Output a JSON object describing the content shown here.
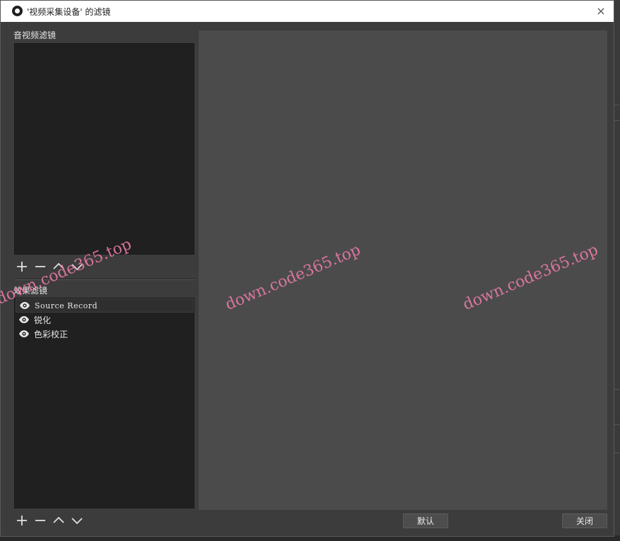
{
  "window": {
    "title": "'视频采集设备' 的滤镜",
    "close_glyph": "×"
  },
  "audio_video_filters": {
    "label": "音视频滤镜",
    "items": []
  },
  "effect_filters": {
    "label": "效果滤镜",
    "items": [
      {
        "label": "Source Record",
        "icon": "eye-icon",
        "selected": true
      },
      {
        "label": "锐化",
        "icon": "eye-icon",
        "selected": false
      },
      {
        "label": "色彩校正",
        "icon": "eye-icon",
        "selected": false
      }
    ]
  },
  "toolbar_icons": [
    "plus-icon",
    "minus-icon",
    "chevron-up-icon",
    "chevron-down-icon"
  ],
  "buttons": {
    "defaults": "默认",
    "close": "关闭"
  },
  "watermark": {
    "text": "down.code365.top"
  },
  "colors": {
    "background": "#3c3c3c",
    "list_bg": "#202020",
    "preview_bg": "#4b4b4b",
    "watermark": "#e87aa6"
  }
}
